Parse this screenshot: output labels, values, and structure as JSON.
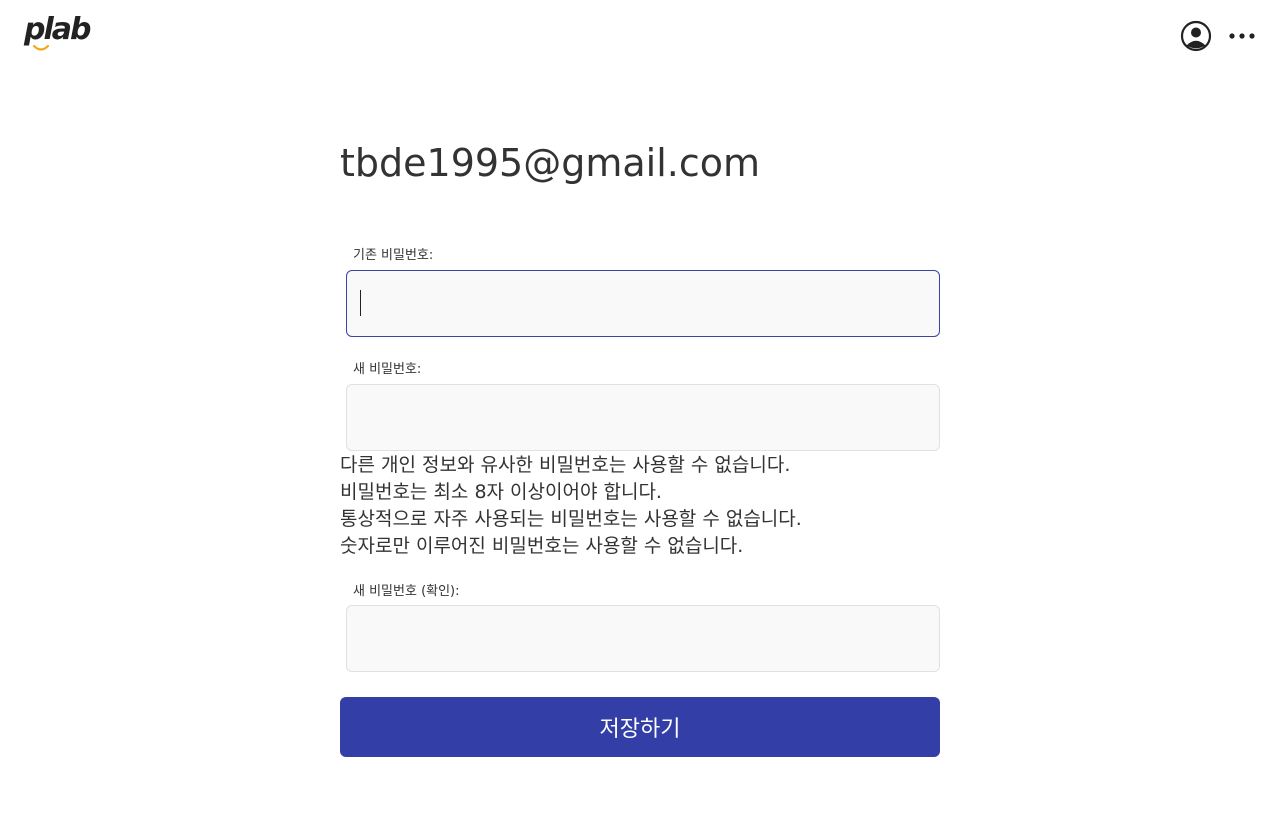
{
  "header": {
    "logo_text": "plab",
    "profile_icon": "user-circle-icon",
    "more_icon": "more-horizontal-icon"
  },
  "account": {
    "email": "tbde1995@gmail.com"
  },
  "form": {
    "current_password_label": "기존 비밀번호:",
    "current_password_value": "",
    "new_password_label": "새 비밀번호:",
    "new_password_value": "",
    "hints": [
      "다른 개인 정보와 유사한 비밀번호는 사용할 수 없습니다.",
      "비밀번호는 최소 8자 이상이어야 합니다.",
      "통상적으로 자주 사용되는 비밀번호는 사용할 수 없습니다.",
      "숫자로만 이루어진 비밀번호는 사용할 수 없습니다."
    ],
    "confirm_password_label": "새 비밀번호 (확인):",
    "confirm_password_value": "",
    "save_label": "저장하기"
  },
  "colors": {
    "primary": "#333ea6",
    "focus_border": "#3a44a3",
    "input_bg": "#f9f9f9",
    "logo_smile": "#f2a81d"
  }
}
